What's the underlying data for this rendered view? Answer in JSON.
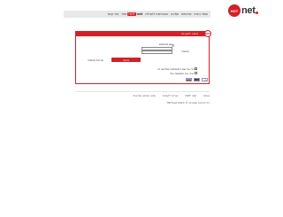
{
  "brand": {
    "logo_circle_text": "HOT",
    "logo_text": "net",
    "accent": "#d32027"
  },
  "nav": {
    "items": [
      {
        "label": "עמוד הבית"
      },
      {
        "label": "שירותים"
      },
      {
        "label": "תמיכה"
      },
      {
        "label": "הצטרפות לחבילה"
      },
      {
        "label": "אזור אישי"
      }
    ],
    "brand_mini_circle": "HOT",
    "brand_mini_text": "net",
    "brand_prefix": "אזור",
    "last_label": "צור קשר"
  },
  "login_panel": {
    "header_title": "כניסה למערכת",
    "badge": "HOT",
    "username_label": "שם משתמש",
    "password_label": "סיסמה",
    "username_value": "",
    "password_value": "",
    "remember_label": "זכור את שם המשתמש במחשב זה",
    "remember2_label": "זכור את הסיסמה שלי",
    "login_button": "כניסה",
    "forgot_link": "שכחתי סיסמה"
  },
  "languages": [
    "Русский",
    "English",
    "עברית"
  ],
  "footer": {
    "links": [
      "אודות",
      "HOT net",
      "שירות לקוחות",
      "תנאי שימוש ופרטיות"
    ],
    "copyright": "HOTnet כל הזכויות שמורות © 2013"
  }
}
